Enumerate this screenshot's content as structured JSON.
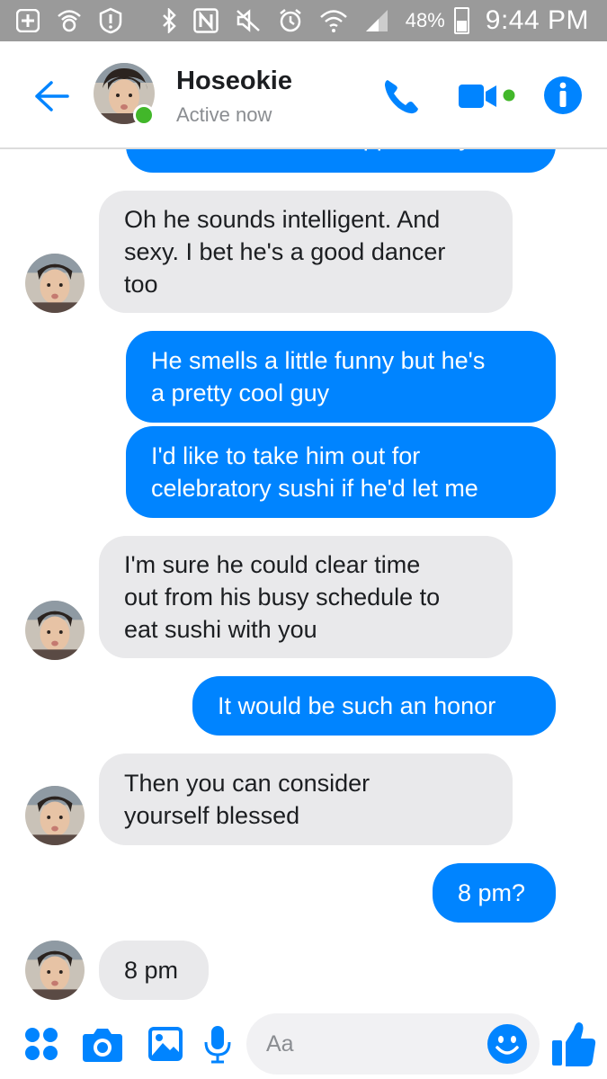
{
  "status_bar": {
    "battery": "48%",
    "time": "9:44 PM",
    "icons": [
      "add-icon",
      "wifi-calling-icon",
      "alert-icon",
      "bluetooth-icon",
      "nfc-icon",
      "mute-icon",
      "alarm-icon",
      "wifi-icon",
      "signal-icon",
      "battery-icon"
    ]
  },
  "header": {
    "back_icon": "back-arrow-icon",
    "contact_name": "Hoseokie",
    "status": "Active now",
    "actions": [
      "phone-icon",
      "video-camera-icon",
      "info-icon"
    ]
  },
  "colors": {
    "accent": "#0084ff",
    "incoming_bubble": "#e9e9eb",
    "active_green": "#42b72a",
    "status_bar": "#9a9a9a"
  },
  "messages": [
    {
      "sender": "me",
      "text": "I could not be happier for you"
    },
    {
      "sender": "contact",
      "text": "Oh he sounds intelligent. And\nsexy. I bet he's a good dancer\ntoo"
    },
    {
      "sender": "me",
      "text": "He smells a little funny but he's\na pretty cool guy"
    },
    {
      "sender": "me",
      "text": "I'd like to take him out for\ncelebratory sushi if he'd let me"
    },
    {
      "sender": "contact",
      "text": "I'm sure he could clear time\nout from his busy schedule to\neat sushi with you"
    },
    {
      "sender": "me",
      "text": "It would be such an honor"
    },
    {
      "sender": "contact",
      "text": "Then you can consider\nyourself blessed"
    },
    {
      "sender": "me",
      "text": "8 pm?"
    },
    {
      "sender": "contact",
      "text": "8 pm"
    }
  ],
  "composer": {
    "placeholder": "Aa",
    "icons": [
      "more-icon",
      "camera-icon",
      "gallery-icon",
      "microphone-icon",
      "emoji-icon",
      "thumbs-up-icon"
    ]
  }
}
